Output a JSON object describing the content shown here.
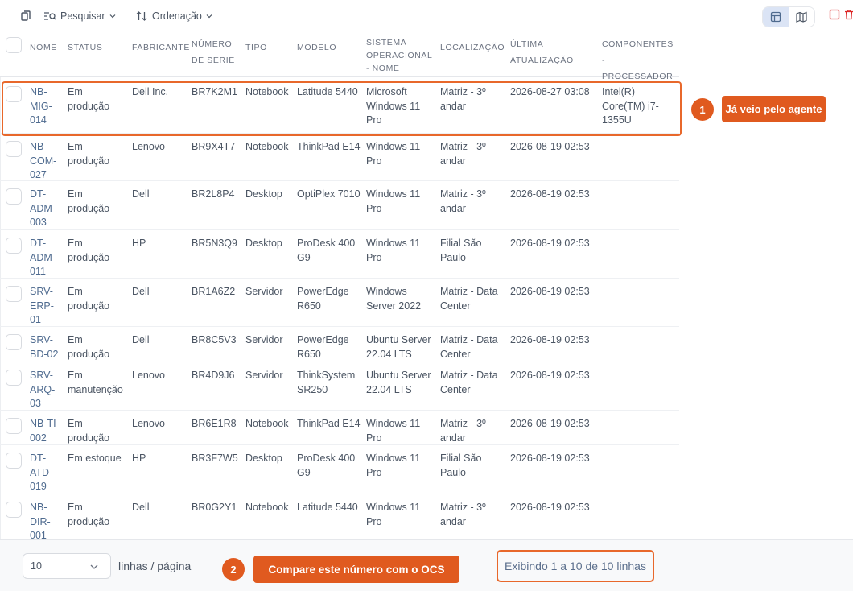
{
  "toolbar": {
    "search_label": "Pesquisar",
    "sort_label": "Ordenação"
  },
  "columns": [
    "NOME",
    "STATUS",
    "FABRICANTE",
    "NÚMERO DE SERIE",
    "TIPO",
    "MODELO",
    "SISTEMA OPERACIONAL - NOME",
    "LOCALIZAÇÃO",
    "ÚLTIMA ATUALIZAÇÃO",
    "COMPONENTES - PROCESSADOR"
  ],
  "rows": [
    {
      "nome": "NB-MIG-014",
      "status": "Em produção",
      "fabricante": "Dell Inc.",
      "serie": "BR7K2M1",
      "tipo": "Notebook",
      "modelo": "Latitude 5440",
      "so": "Microsoft Windows 11 Pro",
      "local": "Matriz - 3º andar",
      "atualizacao": "2026-08-27 03:08",
      "processador": "Intel(R) Core(TM) i7-1355U"
    },
    {
      "nome": "NB-COM-027",
      "status": "Em produção",
      "fabricante": "Lenovo",
      "serie": "BR9X4T7",
      "tipo": "Notebook",
      "modelo": "ThinkPad E14",
      "so": "Windows 11 Pro",
      "local": "Matriz - 3º andar",
      "atualizacao": "2026-08-19 02:53",
      "processador": ""
    },
    {
      "nome": "DT-ADM-003",
      "status": "Em produção",
      "fabricante": "Dell",
      "serie": "BR2L8P4",
      "tipo": "Desktop",
      "modelo": "OptiPlex 7010",
      "so": "Windows 11 Pro",
      "local": "Matriz - 3º andar",
      "atualizacao": "2026-08-19 02:53",
      "processador": ""
    },
    {
      "nome": "DT-ADM-011",
      "status": "Em produção",
      "fabricante": "HP",
      "serie": "BR5N3Q9",
      "tipo": "Desktop",
      "modelo": "ProDesk 400 G9",
      "so": "Windows 11 Pro",
      "local": "Filial São Paulo",
      "atualizacao": "2026-08-19 02:53",
      "processador": ""
    },
    {
      "nome": "SRV-ERP-01",
      "status": "Em produção",
      "fabricante": "Dell",
      "serie": "BR1A6Z2",
      "tipo": "Servidor",
      "modelo": "PowerEdge R650",
      "so": "Windows Server 2022",
      "local": "Matriz - Data Center",
      "atualizacao": "2026-08-19 02:53",
      "processador": ""
    },
    {
      "nome": "SRV-BD-02",
      "status": "Em produção",
      "fabricante": "Dell",
      "serie": "BR8C5V3",
      "tipo": "Servidor",
      "modelo": "PowerEdge R650",
      "so": "Ubuntu Server 22.04 LTS",
      "local": "Matriz - Data Center",
      "atualizacao": "2026-08-19 02:53",
      "processador": ""
    },
    {
      "nome": "SRV-ARQ-03",
      "status": "Em manutenção",
      "fabricante": "Lenovo",
      "serie": "BR4D9J6",
      "tipo": "Servidor",
      "modelo": "ThinkSystem SR250",
      "so": "Ubuntu Server 22.04 LTS",
      "local": "Matriz - Data Center",
      "atualizacao": "2026-08-19 02:53",
      "processador": ""
    },
    {
      "nome": "NB-TI-002",
      "status": "Em produção",
      "fabricante": "Lenovo",
      "serie": "BR6E1R8",
      "tipo": "Notebook",
      "modelo": "ThinkPad E14",
      "so": "Windows 11 Pro",
      "local": "Matriz - 3º andar",
      "atualizacao": "2026-08-19 02:53",
      "processador": ""
    },
    {
      "nome": "DT-ATD-019",
      "status": "Em estoque",
      "fabricante": "HP",
      "serie": "BR3F7W5",
      "tipo": "Desktop",
      "modelo": "ProDesk 400 G9",
      "so": "Windows 11 Pro",
      "local": "Filial São Paulo",
      "atualizacao": "2026-08-19 02:53",
      "processador": ""
    },
    {
      "nome": "NB-DIR-001",
      "status": "Em produção",
      "fabricante": "Dell",
      "serie": "BR0G2Y1",
      "tipo": "Notebook",
      "modelo": "Latitude 5440",
      "so": "Windows 11 Pro",
      "local": "Matriz - 3º andar",
      "atualizacao": "2026-08-19 02:53",
      "processador": ""
    }
  ],
  "annotations": {
    "badge1": "1",
    "callout1": "Já veio pelo agente",
    "badge2": "2",
    "callout2": "Compare este número com o OCS"
  },
  "footer": {
    "page_size": "10",
    "page_size_label": "linhas / página",
    "showing": "Exibindo 1 a 10 de 10 linhas"
  },
  "icons": {
    "bookmark": "bookmark-icon",
    "search": "search-list-icon",
    "sort": "sort-arrows-icon",
    "table_view": "table-view-icon",
    "map_view": "map-view-icon",
    "checkbox_red": "checkbox-outline-icon",
    "trash": "trash-icon"
  },
  "colors": {
    "accent": "#e05a1f",
    "highlight_border": "#e8682b",
    "name_text": "#4f6b8f",
    "danger": "#dc2626"
  }
}
